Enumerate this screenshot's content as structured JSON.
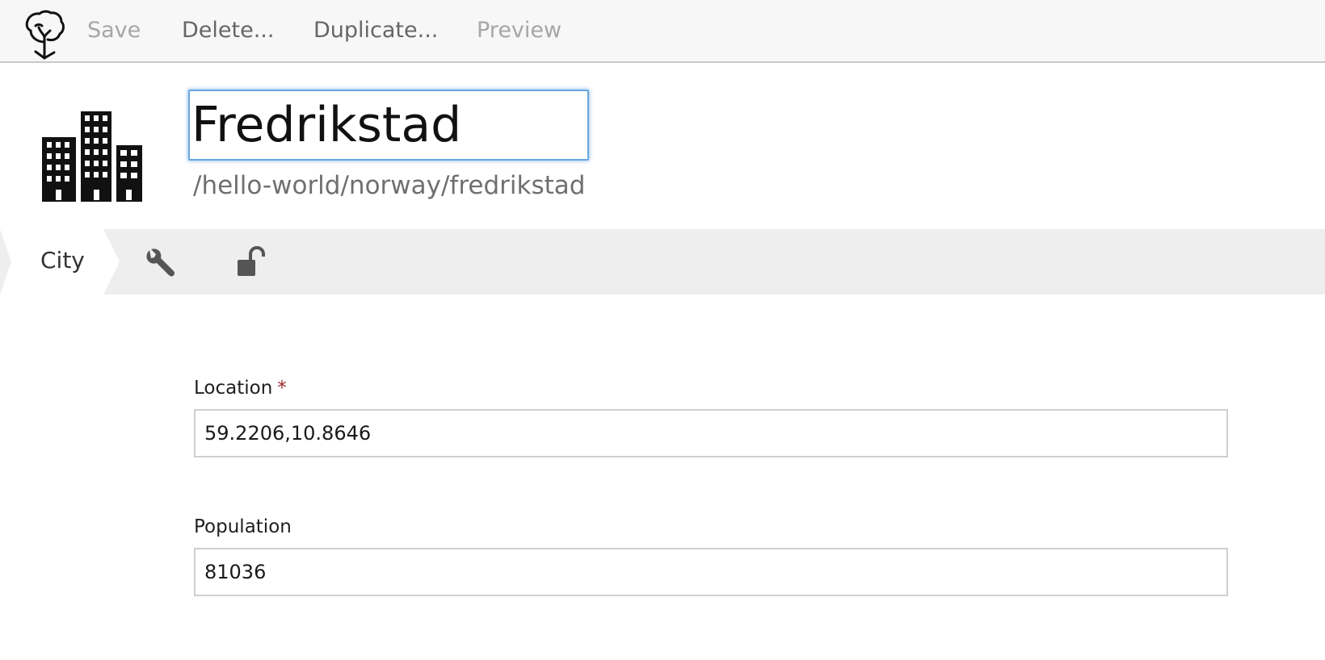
{
  "toolbar": {
    "logo_icon": "tree-logo-icon",
    "save_label": "Save",
    "delete_label": "Delete...",
    "duplicate_label": "Duplicate...",
    "preview_label": "Preview"
  },
  "header": {
    "type_icon": "city-buildings-icon",
    "title": "Fredrikstad",
    "path": "/hello-world/norway/fredrikstad"
  },
  "tabs": {
    "city_label": "City",
    "settings_icon": "wrench-icon",
    "security_icon": "unlock-icon"
  },
  "form": {
    "location": {
      "label": "Location",
      "required_marker": "*",
      "value": "59.2206,10.8646"
    },
    "population": {
      "label": "Population",
      "value": "81036"
    }
  },
  "colors": {
    "focus_border": "#6aa7df",
    "required": "#a0282b",
    "toolbar_bg": "#f7f7f7",
    "tabbar_bg": "#eeeeee"
  }
}
